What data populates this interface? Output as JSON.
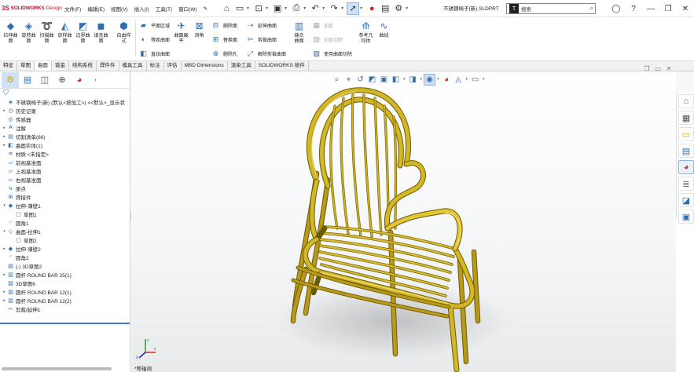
{
  "app": {
    "logo_ds": "3S",
    "logo_name": "SOLIDWORKS",
    "logo_suffix": "Design",
    "doc_title": "不锈钢椅子(新).SLDPRT",
    "search_placeholder": "搜索",
    "search_prefix": "T"
  },
  "menu": [
    "文件(F)",
    "编辑(E)",
    "视图(V)",
    "插入(I)",
    "工具(T)",
    "窗口(W)"
  ],
  "ribbon": {
    "big1": [
      {
        "l1": "拉伸曲",
        "l2": "面"
      },
      {
        "l1": "旋转曲",
        "l2": "面"
      },
      {
        "l1": "扫描曲",
        "l2": "面"
      },
      {
        "l1": "放样曲",
        "l2": "面"
      },
      {
        "l1": "边界曲",
        "l2": "面"
      },
      {
        "l1": "填充曲",
        "l2": "面"
      },
      {
        "l1": "自由样",
        "l2": "式"
      }
    ],
    "col1": [
      "平面区域",
      "等距曲面",
      "直纹曲面"
    ],
    "big2": [
      {
        "l1": "曲面展",
        "l2": "平"
      },
      {
        "l1": "删除",
        "l2": "面"
      }
    ],
    "big2b": {
      "l1": "测角",
      "l2": ""
    },
    "col2": [
      "删除面",
      "替换面",
      "删除孔"
    ],
    "col3": [
      "延伸曲面",
      "剪裁曲面",
      "解除剪裁曲面"
    ],
    "big3": {
      "l1": "缝合",
      "l2": "曲面"
    },
    "col4": [
      "加厚",
      "加厚切除",
      "使用曲面切除"
    ],
    "big4": [
      {
        "l1": "参考几",
        "l2": "何体"
      },
      {
        "l1": "曲线",
        "l2": ""
      }
    ]
  },
  "tabs": [
    "特征",
    "草图",
    "曲面",
    "钣金",
    "结构系统",
    "焊件件",
    "模具工具",
    "标注",
    "评估",
    "MBD Dimensions",
    "渲染工具",
    "SOLIDWORKS 插件"
  ],
  "active_tab": "曲面",
  "tree": [
    {
      "lvl": 0,
      "ex": "",
      "icon": "part-icon",
      "label": "不锈钢椅子(新) (默认<按加工>) <<默认>_显示状"
    },
    {
      "lvl": 0,
      "ex": "▸",
      "icon": "history-icon",
      "label": "历史记录"
    },
    {
      "lvl": 0,
      "ex": "",
      "icon": "sensor-icon",
      "label": "传感器"
    },
    {
      "lvl": 0,
      "ex": "▸",
      "icon": "annotation-icon",
      "label": "注解"
    },
    {
      "lvl": 0,
      "ex": "▸",
      "icon": "cutlist-icon",
      "label": "切割清单(66)"
    },
    {
      "lvl": 0,
      "ex": "▸",
      "icon": "surface-body-icon",
      "label": "曲面实体(1)"
    },
    {
      "lvl": 0,
      "ex": "",
      "icon": "material-icon",
      "label": "材质 <未指定>"
    },
    {
      "lvl": 0,
      "ex": "",
      "icon": "plane-icon",
      "label": "前视基准面"
    },
    {
      "lvl": 0,
      "ex": "",
      "icon": "plane-icon",
      "label": "上视基准面"
    },
    {
      "lvl": 0,
      "ex": "",
      "icon": "plane-icon",
      "label": "右视基准面"
    },
    {
      "lvl": 0,
      "ex": "",
      "icon": "origin-icon",
      "label": "原点"
    },
    {
      "lvl": 0,
      "ex": "",
      "icon": "weldment-icon",
      "label": "焊接件"
    },
    {
      "lvl": 0,
      "ex": "▾",
      "icon": "extrude-icon",
      "label": "拉伸-薄壁1"
    },
    {
      "lvl": 1,
      "ex": "",
      "icon": "sketch-icon",
      "label": "草图1"
    },
    {
      "lvl": 0,
      "ex": "",
      "icon": "fillet-icon",
      "label": "圆角1"
    },
    {
      "lvl": 0,
      "ex": "▾",
      "icon": "surface-extrude-icon",
      "label": "曲面-拉伸1"
    },
    {
      "lvl": 1,
      "ex": "",
      "icon": "sketch-icon",
      "label": "草图2"
    },
    {
      "lvl": 0,
      "ex": "▸",
      "icon": "extrude-icon",
      "label": "拉伸-薄壁2"
    },
    {
      "lvl": 0,
      "ex": "",
      "icon": "fillet-icon",
      "label": "圆角2"
    },
    {
      "lvl": 0,
      "ex": "",
      "icon": "3dsketch-icon",
      "label": "(-) 3D草图2"
    },
    {
      "lvl": 0,
      "ex": "▸",
      "icon": "structural-member-icon",
      "label": "圆杆 ROUND BAR 25(1)"
    },
    {
      "lvl": 0,
      "ex": "",
      "icon": "3dsketch-icon",
      "label": "3D草图6"
    },
    {
      "lvl": 0,
      "ex": "▸",
      "icon": "structural-member-icon",
      "label": "圆杆 ROUND BAR 12(1)"
    },
    {
      "lvl": 0,
      "ex": "▸",
      "icon": "structural-member-icon",
      "label": "圆杆 ROUND BAR 12(2)"
    },
    {
      "lvl": 0,
      "ex": "",
      "icon": "trim-extend-icon",
      "label": "剪裁/延伸1"
    }
  ],
  "viewport": {
    "view_label": "*等轴测",
    "triad_x": "x",
    "triad_y": "y",
    "triad_z": "z"
  },
  "colors": {
    "chair_gold": "#b89a18",
    "chair_dark": "#6b5a08",
    "chair_light": "#f2e27a",
    "accent_blue": "#3a7bd5",
    "brand_red": "#c8102e"
  }
}
